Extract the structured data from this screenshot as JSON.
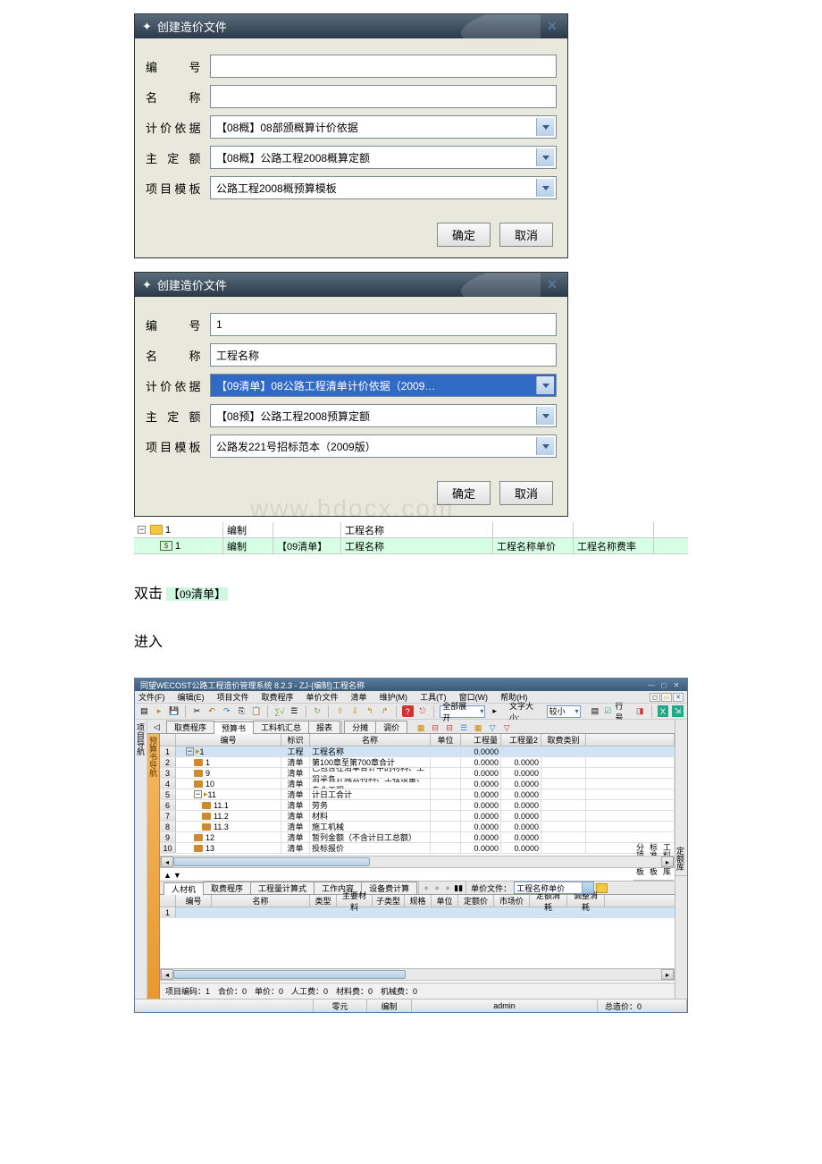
{
  "dialog1": {
    "title": "创建造价文件",
    "labels": {
      "code": "编　　号",
      "name": "名　　称",
      "basis": "计价依据",
      "quota": "主 定 额",
      "template": "项目模板"
    },
    "values": {
      "code": "",
      "name": "",
      "basis": "【08概】08部颁概算计价依据",
      "quota": "【08概】公路工程2008概算定额",
      "template": "公路工程2008概预算模板"
    },
    "ok": "确定",
    "cancel": "取消"
  },
  "dialog2": {
    "title": "创建造价文件",
    "labels": {
      "code": "编　　号",
      "name": "名　　称",
      "basis": "计价依据",
      "quota": "主 定 额",
      "template": "项目模板"
    },
    "values": {
      "code": "1",
      "name": "工程名称",
      "basis": "【09清单】08公路工程清单计价依据（2009…",
      "quota": "【08预】公路工程2008预算定额",
      "template": "公路发221号招标范本（2009版）"
    },
    "ok": "确定",
    "cancel": "取消"
  },
  "tree": {
    "r1": {
      "ind": "1",
      "a": "编制",
      "b": "",
      "c": "工程名称",
      "d": "",
      "e": ""
    },
    "r2": {
      "ind": "1",
      "a": "编制",
      "b": "【09清单】",
      "c": "工程名称",
      "d": "工程名称单价",
      "e": "工程名称费率"
    }
  },
  "text": {
    "dblclick": "双击",
    "tag": "【09清单】",
    "enter": "进入"
  },
  "app": {
    "title": "同望WECOST公路工程造价管理系统 8.2.3 - ZJ-{编制}工程名称",
    "menus": [
      "文件(F)",
      "编辑(E)",
      "项目文件",
      "取费程序",
      "单价文件",
      "清单",
      "维护(M)",
      "工具(T)",
      "窗口(W)",
      "帮助(H)"
    ],
    "toolbar2": {
      "expand": "全部展开",
      "fontsize": "文字大小:",
      "fontsize_val": "较小",
      "lineno": "行号"
    },
    "tabs": [
      "取费程序",
      "预算书",
      "工料机汇总",
      "报表"
    ],
    "subtabs": [
      "分摊",
      "调价"
    ],
    "grid_header": {
      "num": "编号",
      "mark": "标识",
      "name": "名称",
      "unit": "单位",
      "q1": "工程量",
      "q2": "工程量2",
      "cat": "取费类别"
    },
    "rows": [
      {
        "num": "1",
        "mark": "工程",
        "name": "工程名称",
        "q1": "0.0000",
        "q2": "",
        "indent": 0,
        "tree": "minus",
        "icon": "folder"
      },
      {
        "num": "1",
        "mark": "清单",
        "name": "第100章至第700章合计",
        "q1": "0.0000",
        "q2": "0.0000",
        "indent": 1,
        "icon": "page"
      },
      {
        "num": "9",
        "mark": "清单",
        "name": "已包含在清单合计中的材料、工程设备、…",
        "q1": "0.0000",
        "q2": "0.0000",
        "indent": 1,
        "icon": "page"
      },
      {
        "num": "10",
        "mark": "清单",
        "name": "清单合计减去材料、工程设备、专业工程…",
        "q1": "0.0000",
        "q2": "0.0000",
        "indent": 1,
        "icon": "page"
      },
      {
        "num": "11",
        "mark": "清单",
        "name": "计日工合计",
        "q1": "0.0000",
        "q2": "0.0000",
        "indent": 1,
        "tree": "minus",
        "icon": "folder"
      },
      {
        "num": "11.1",
        "mark": "清单",
        "name": "劳务",
        "q1": "0.0000",
        "q2": "0.0000",
        "indent": 2,
        "icon": "page"
      },
      {
        "num": "11.2",
        "mark": "清单",
        "name": "材料",
        "q1": "0.0000",
        "q2": "0.0000",
        "indent": 2,
        "icon": "page"
      },
      {
        "num": "11.3",
        "mark": "清单",
        "name": "施工机械",
        "q1": "0.0000",
        "q2": "0.0000",
        "indent": 2,
        "icon": "page"
      },
      {
        "num": "12",
        "mark": "清单",
        "name": "暂列金额（不含计日工总额）",
        "q1": "0.0000",
        "q2": "0.0000",
        "indent": 1,
        "icon": "page"
      },
      {
        "num": "13",
        "mark": "清单",
        "name": "投标报价",
        "q1": "0.0000",
        "q2": "0.0000",
        "indent": 1,
        "icon": "page"
      }
    ],
    "bottom_tabs": [
      "人材机",
      "取费程序",
      "工程量计算式",
      "工作内容",
      "设备费计算"
    ],
    "price_file_label": "单价文件：",
    "price_file_val": "工程名称单价",
    "sub_header": [
      "编号",
      "名称",
      "类型",
      "主要材料",
      "子类型",
      "规格",
      "单位",
      "定额价",
      "市场价",
      "定额消耗",
      "调整消耗"
    ],
    "status_line": "项目编码：1　合价：0　单价：0　人工费：0　材料费：0　机械费：0",
    "status_bar": {
      "amount": "零元",
      "mode": "编制",
      "user": "admin",
      "total": "总造价：0"
    },
    "side_left": "项目导航",
    "nav_left": "预算书导航",
    "side_right": [
      "定额库",
      "工料机库",
      "标准模板",
      "分项模板"
    ]
  }
}
